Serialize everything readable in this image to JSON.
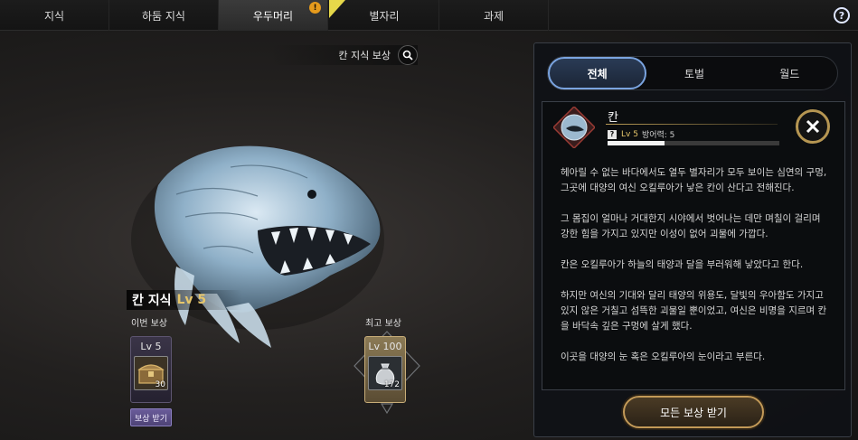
{
  "tabs": [
    {
      "label": "지식"
    },
    {
      "label": "하둠 지식"
    },
    {
      "label": "우두머리",
      "active": true,
      "alert": "!"
    },
    {
      "label": "별자리"
    },
    {
      "label": "과제"
    }
  ],
  "help_label": "?",
  "search": {
    "label": "칸 지식 보상",
    "icon": "search-icon"
  },
  "knowledge": {
    "name": "칸 지식",
    "level": "Lv 5"
  },
  "current_reward": {
    "label": "이번 보상",
    "level": "Lv 5",
    "icon": "treasure-chest-icon",
    "quantity": "30",
    "claim_label": "보상 받기"
  },
  "best_reward": {
    "label": "최고 보상",
    "level": "Lv 100",
    "icon": "pouch-icon",
    "quantity": "172"
  },
  "panel": {
    "filters": [
      {
        "label": "전체",
        "active": true
      },
      {
        "label": "토벌"
      },
      {
        "label": "월드"
      }
    ],
    "boss": {
      "name": "칸",
      "level": "Lv 5",
      "defense": "방어력: 5",
      "stat_badge": "?",
      "progress": 0.33,
      "portrait_icon": "kharn-portrait-icon"
    },
    "description": [
      "헤아릴 수 없는 바다에서도 열두 별자리가 모두 보이는 심연의 구멍, 그곳에 대양의 여신 오킬루아가 낳은 칸이 산다고 전해진다.",
      "그 몸집이 얼마나 거대한지 시야에서 벗어나는 데만 며칠이 걸리며 강한 힘을 가지고 있지만 이성이 없어 괴물에 가깝다.",
      "칸은 오킬루아가 하늘의 태양과 달을 부러워해 낳았다고 한다.",
      "하지만 여신의 기대와 달리 태양의 위용도, 달빛의 우아함도 가지고 있지 않은 거칠고 섬뜩한 괴물일 뿐이었고, 여신은 비명을 지르며 칸을 바닥속 깊은 구멍에 살게 했다.",
      "이곳을 대양의 눈 혹은 오킬루아의 눈이라고 부른다."
    ],
    "claim_all_label": "모든 보상 받기"
  },
  "colors": {
    "accent_gold": "#c39a58",
    "level_gold": "#e6c66b",
    "tab_alert": "#e59a1c",
    "active_segment": "#7aa4e0",
    "claim_purple": "#6a5c9a"
  }
}
